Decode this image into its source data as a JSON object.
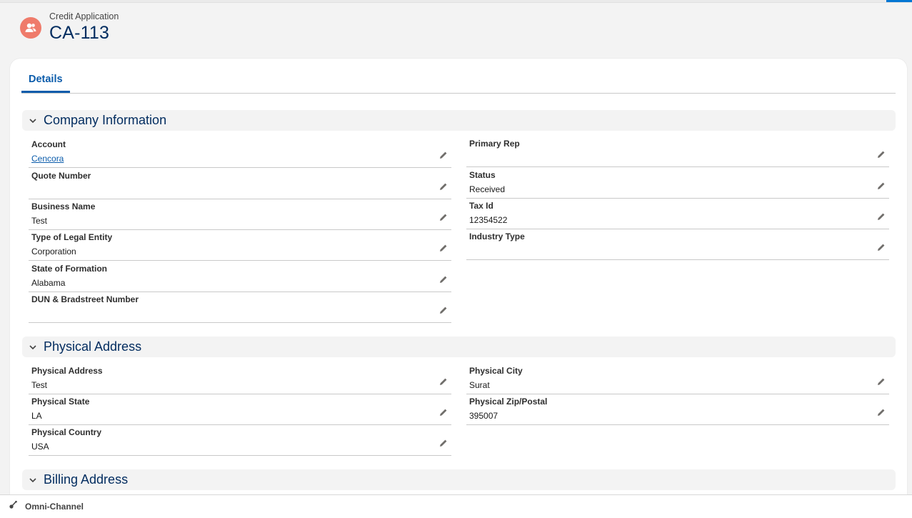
{
  "header": {
    "object_name": "Credit Application",
    "record_name": "CA-113",
    "icon": "user-group-icon"
  },
  "tabs": [
    {
      "label": "Details",
      "active": true
    }
  ],
  "sections": [
    {
      "title": "Company Information",
      "fields_left": [
        {
          "label": "Account",
          "value": "Cencora",
          "link": true
        },
        {
          "label": "Quote Number",
          "value": ""
        },
        {
          "label": "Business Name",
          "value": "Test"
        },
        {
          "label": "Type of Legal Entity",
          "value": "Corporation"
        },
        {
          "label": "State of Formation",
          "value": "Alabama"
        },
        {
          "label": "DUN & Bradstreet Number",
          "value": ""
        }
      ],
      "fields_right": [
        {
          "label": "Primary Rep",
          "value": ""
        },
        {
          "label": "Status",
          "value": "Received"
        },
        {
          "label": "Tax Id",
          "value": "12354522"
        },
        {
          "label": "Industry Type",
          "value": ""
        }
      ]
    },
    {
      "title": "Physical Address",
      "fields_left": [
        {
          "label": "Physical Address",
          "value": "Test"
        },
        {
          "label": "Physical State",
          "value": "LA"
        },
        {
          "label": "Physical Country",
          "value": "USA"
        }
      ],
      "fields_right": [
        {
          "label": "Physical City",
          "value": "Surat"
        },
        {
          "label": "Physical Zip/Postal",
          "value": "395007"
        }
      ]
    },
    {
      "title": "Billing Address",
      "fields_left": [],
      "fields_right": []
    }
  ],
  "footer": {
    "omni_channel_label": "Omni-Channel",
    "icon": "headset-icon"
  },
  "colors": {
    "brand_blue": "#0b5cab",
    "title_navy": "#032d60",
    "record_icon_bg": "#ef7b6b",
    "page_bg": "#f3f3f3"
  }
}
